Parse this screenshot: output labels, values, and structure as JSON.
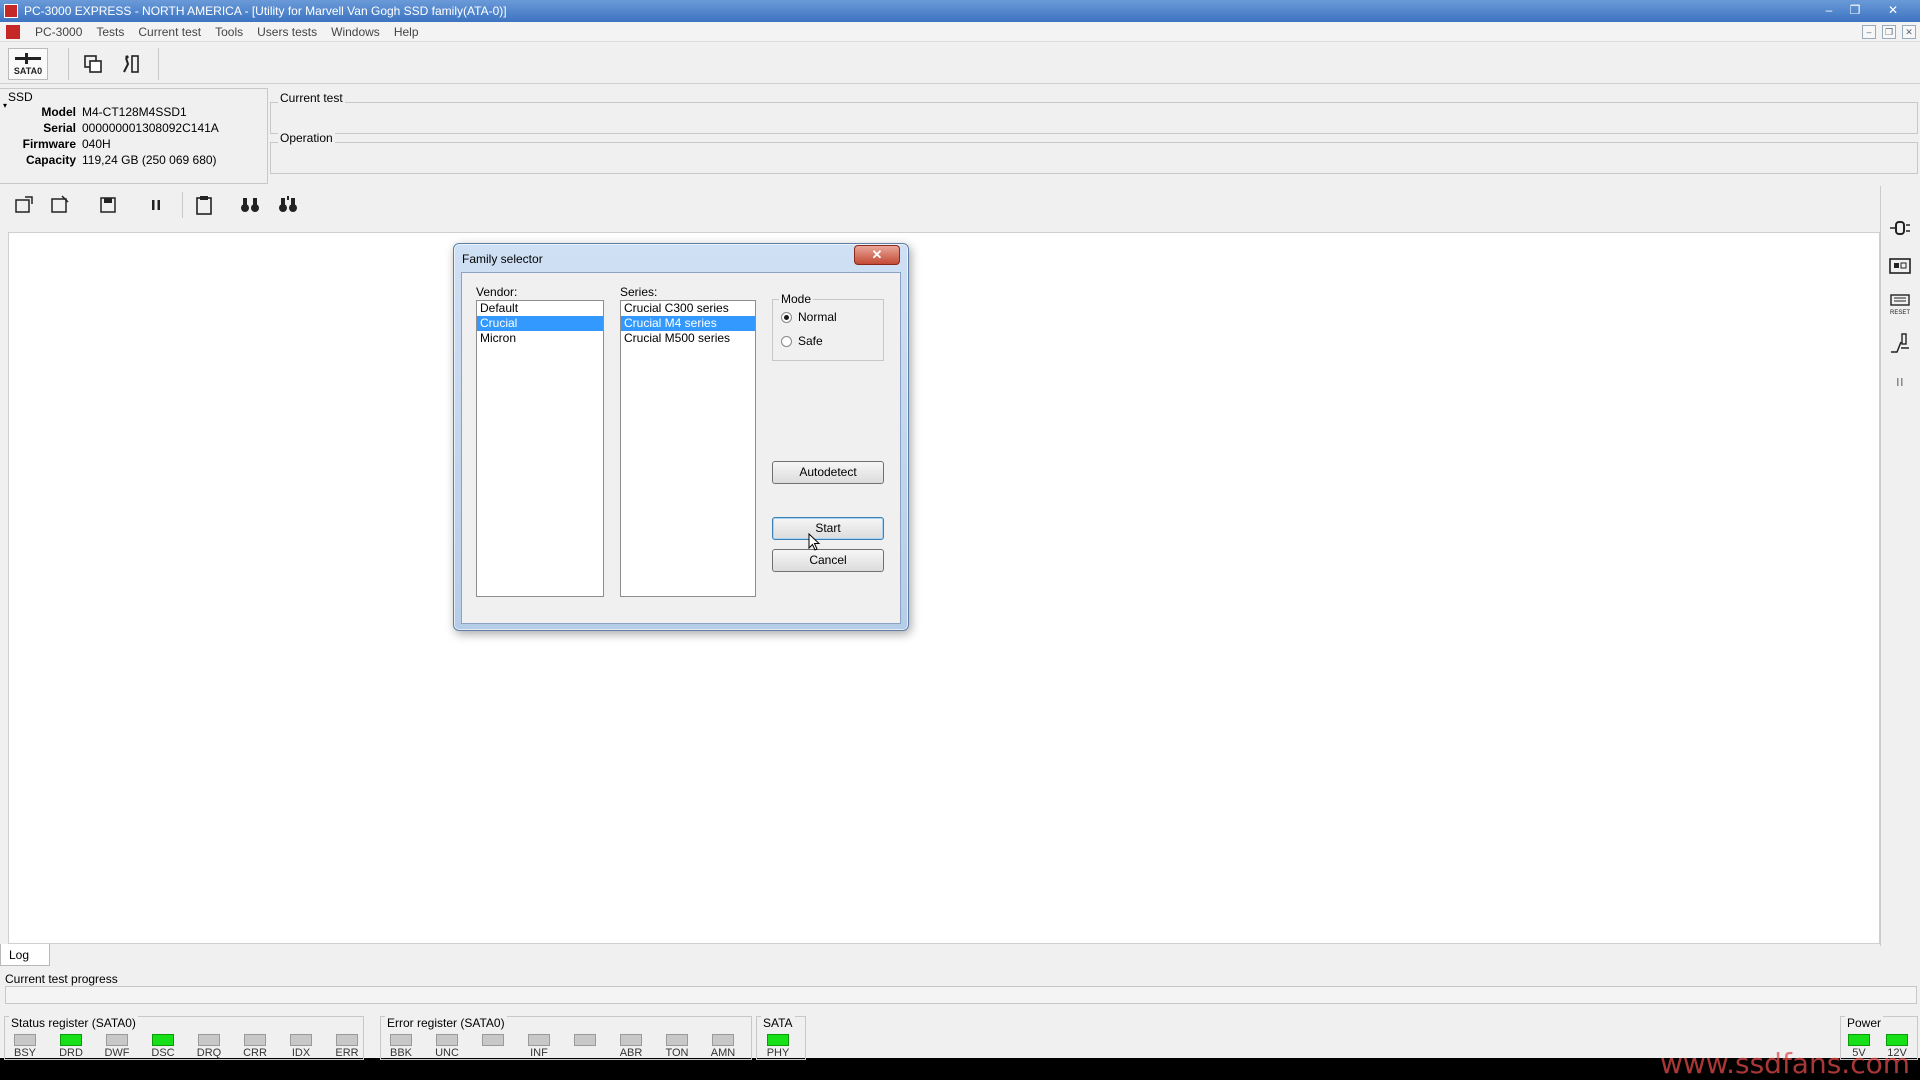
{
  "window": {
    "title": "PC-3000 EXPRESS - NORTH AMERICA - [Utility for Marvell Van Gogh SSD family(ATA-0)]",
    "controls": [
      "–",
      "❐",
      "✕"
    ]
  },
  "menu": {
    "items": [
      "PC-3000",
      "Tests",
      "Current test",
      "Tools",
      "Users tests",
      "Windows",
      "Help"
    ]
  },
  "toolbar": {
    "sata_label": "SATA0"
  },
  "ssd": {
    "caption": "SSD",
    "fields": [
      {
        "key": "Model",
        "value": "M4-CT128M4SSD1"
      },
      {
        "key": "Serial",
        "value": "000000001308092C141A"
      },
      {
        "key": "Firmware",
        "value": "040H"
      },
      {
        "key": "Capacity",
        "value": "119,24 GB (250 069 680)"
      }
    ]
  },
  "panels": {
    "current_test": "Current test",
    "operation": "Operation"
  },
  "dialog": {
    "title": "Family selector",
    "vendor_label": "Vendor:",
    "vendors": [
      "Default",
      "Crucial",
      "Micron"
    ],
    "vendor_selected": 1,
    "series_label": "Series:",
    "series": [
      "Crucial C300 series",
      "Crucial M4 series",
      "Crucial M500 series"
    ],
    "series_selected": 1,
    "mode_label": "Mode",
    "mode_options": [
      "Normal",
      "Safe"
    ],
    "mode_selected": 0,
    "autodetect": "Autodetect",
    "start": "Start",
    "cancel": "Cancel"
  },
  "bottom": {
    "log_tab": "Log",
    "progress_label": "Current test progress",
    "status_register": {
      "label": "Status register (SATA0)",
      "leds": [
        {
          "name": "BSY",
          "on": false
        },
        {
          "name": "DRD",
          "on": true
        },
        {
          "name": "DWF",
          "on": false
        },
        {
          "name": "DSC",
          "on": true
        },
        {
          "name": "DRQ",
          "on": false
        },
        {
          "name": "CRR",
          "on": false
        },
        {
          "name": "IDX",
          "on": false
        },
        {
          "name": "ERR",
          "on": false
        }
      ]
    },
    "error_register": {
      "label": "Error register (SATA0)",
      "leds": [
        {
          "name": "BBK",
          "on": false
        },
        {
          "name": "UNC",
          "on": false
        },
        {
          "name": "",
          "on": false
        },
        {
          "name": "INF",
          "on": false
        },
        {
          "name": "",
          "on": false
        },
        {
          "name": "ABR",
          "on": false
        },
        {
          "name": "TON",
          "on": false
        },
        {
          "name": "AMN",
          "on": false
        }
      ]
    },
    "sata": {
      "label": "SATA",
      "leds": [
        {
          "name": "PHY",
          "on": true
        }
      ]
    },
    "power": {
      "label": "Power",
      "leds": [
        {
          "name": "5V",
          "on": true
        },
        {
          "name": "12V",
          "on": true
        }
      ]
    }
  },
  "watermark": "www.ssdfans.com",
  "colors": {
    "selection": "#3399ff",
    "led_on": "#18e018",
    "titlebar": "#3d74c1"
  }
}
